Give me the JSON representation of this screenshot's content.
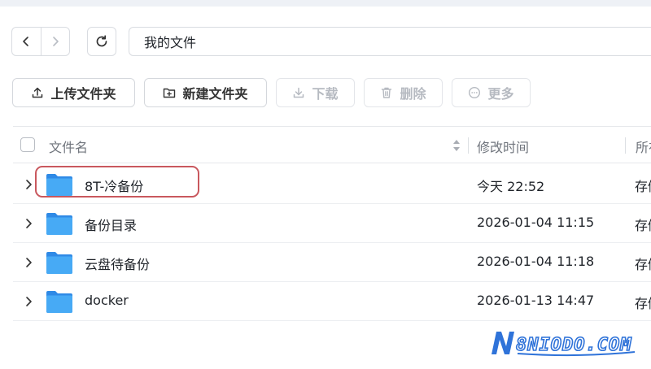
{
  "nav": {
    "back_icon": "chevron-left-icon",
    "forward_icon": "chevron-right-icon",
    "refresh_icon": "refresh-icon",
    "path": "我的文件"
  },
  "toolbar": {
    "upload_folder": "上传文件夹",
    "new_folder": "新建文件夹",
    "download": "下载",
    "delete": "删除",
    "more": "更多"
  },
  "table": {
    "headers": {
      "name": "文件名",
      "modified": "修改时间",
      "location": "所在"
    },
    "rows": [
      {
        "name": "8T-冷备份",
        "modified": "今天 22:52",
        "location": "存储"
      },
      {
        "name": "备份目录",
        "modified": "2026-01-04 11:15",
        "location": "存储"
      },
      {
        "name": "云盘待备份",
        "modified": "2026-01-04 11:18",
        "location": "存储"
      },
      {
        "name": "docker",
        "modified": "2026-01-13 14:47",
        "location": "存储"
      }
    ]
  },
  "watermark": {
    "text": "8NIODO.COM"
  },
  "colors": {
    "folder": "#3b9bf0",
    "highlight": "#c9585e",
    "disabled": "#b6bac1"
  }
}
